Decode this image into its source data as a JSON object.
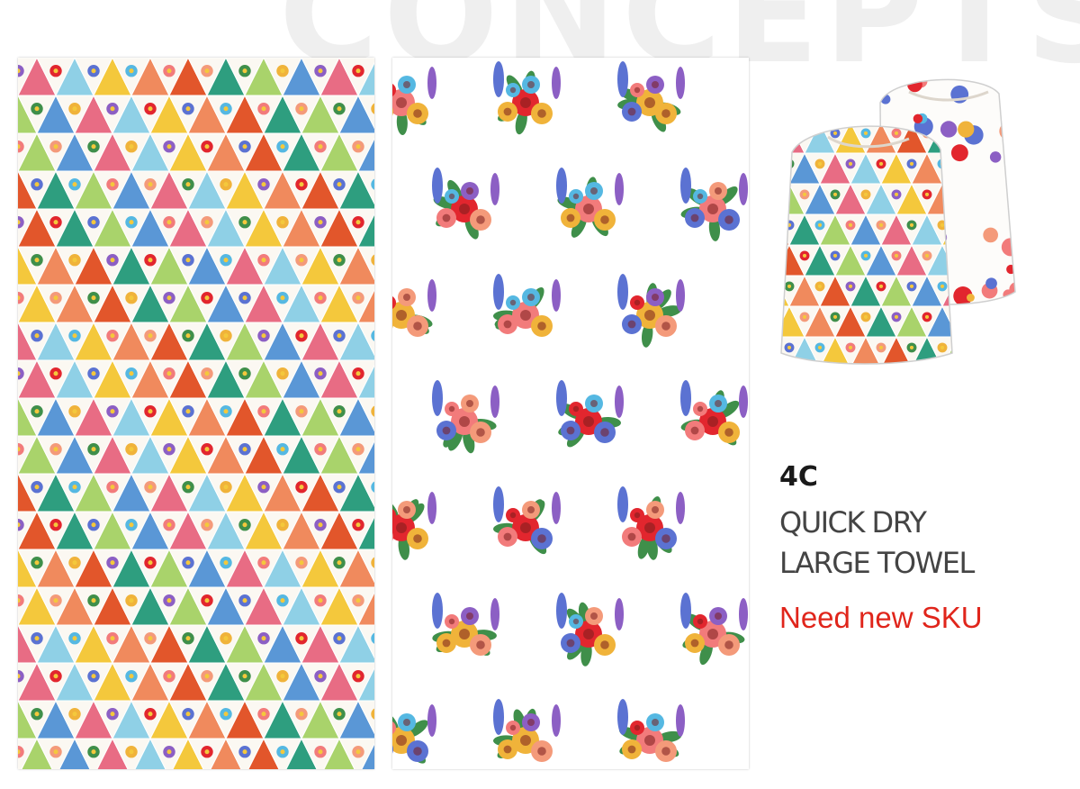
{
  "background_heading": "CONCEPTS",
  "product": {
    "code": "4C",
    "name_line1": "QUICK DRY",
    "name_line2": "LARGE TOWEL",
    "note": "Need new SKU"
  },
  "colors": {
    "note_red": "#e0251b",
    "triangle_palette": [
      "#e86c84",
      "#2e9e7f",
      "#f4c83c",
      "#5a97d6",
      "#e2562b",
      "#8fd0e6",
      "#a9d36b",
      "#f08a5d"
    ],
    "flower_palette": [
      "#e2262e",
      "#f27b7b",
      "#f0b33a",
      "#5b72d2",
      "#f49a7a",
      "#8c5fc4",
      "#55b8e2",
      "#3f8f4a"
    ]
  },
  "images": {
    "towel_left": "harlequin diamond patchwork towel",
    "towel_right": "floral bouquet print towel",
    "bags": "drawstring pouches"
  }
}
